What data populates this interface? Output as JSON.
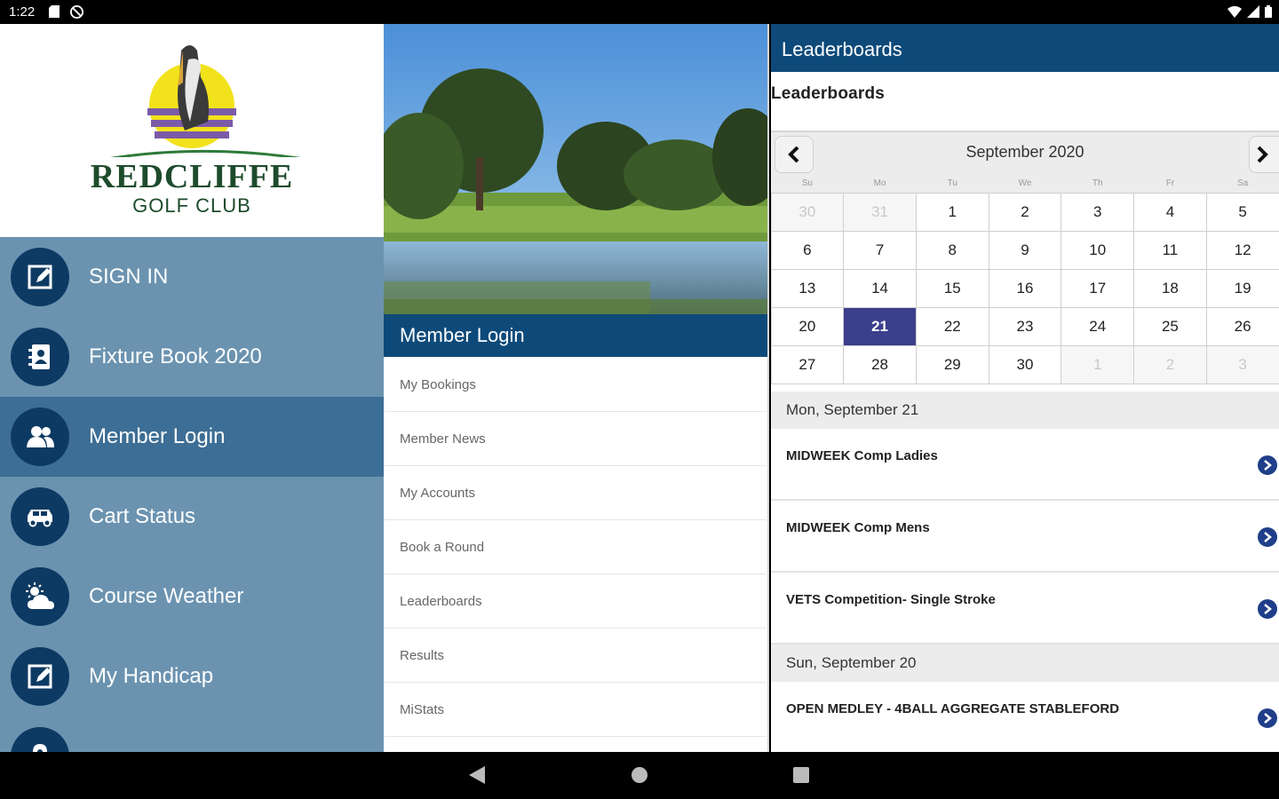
{
  "status_bar": {
    "time": "1:22",
    "left_icons": [
      "sd-card-icon",
      "no-disturb-icon"
    ],
    "right_icons": [
      "wifi-icon",
      "cell-signal-icon",
      "battery-icon"
    ]
  },
  "brand": {
    "title": "REDCLIFFE",
    "subtitle": "GOLF CLUB",
    "colors": {
      "logo_green": "#1e4b2c",
      "sun_yellow": "#f2e21c",
      "water_purple": "#7b5ba8"
    }
  },
  "sidebar": {
    "items": [
      {
        "label": "SIGN IN",
        "icon": "edit-icon",
        "active": false
      },
      {
        "label": "Fixture Book 2020",
        "icon": "contact-book-icon",
        "active": false
      },
      {
        "label": "Member Login",
        "icon": "people-icon",
        "active": true
      },
      {
        "label": "Cart Status",
        "icon": "car-icon",
        "active": false
      },
      {
        "label": "Course Weather",
        "icon": "weather-icon",
        "active": false
      },
      {
        "label": "My Handicap",
        "icon": "edit-icon",
        "active": false
      }
    ],
    "colors": {
      "background": "#6b93b0",
      "active": "#3d6e95",
      "icon_circle": "#0d3a63"
    }
  },
  "member_panel": {
    "title": "Member Login",
    "items": [
      "My Bookings",
      "Member News",
      "My Accounts",
      "Book a Round",
      "Leaderboards",
      "Results",
      "MiStats"
    ]
  },
  "leaderboards": {
    "header": "Leaderboards",
    "subtitle": "Leaderboards",
    "calendar": {
      "month_label": "September 2020",
      "dow": [
        "Su",
        "Mo",
        "Tu",
        "We",
        "Th",
        "Fr",
        "Sa"
      ],
      "weeks": [
        [
          {
            "d": "30",
            "out": true
          },
          {
            "d": "31",
            "out": true
          },
          {
            "d": "1"
          },
          {
            "d": "2"
          },
          {
            "d": "3"
          },
          {
            "d": "4"
          },
          {
            "d": "5"
          }
        ],
        [
          {
            "d": "6"
          },
          {
            "d": "7"
          },
          {
            "d": "8"
          },
          {
            "d": "9"
          },
          {
            "d": "10"
          },
          {
            "d": "11"
          },
          {
            "d": "12"
          }
        ],
        [
          {
            "d": "13"
          },
          {
            "d": "14"
          },
          {
            "d": "15"
          },
          {
            "d": "16"
          },
          {
            "d": "17"
          },
          {
            "d": "18"
          },
          {
            "d": "19"
          }
        ],
        [
          {
            "d": "20"
          },
          {
            "d": "21",
            "selected": true
          },
          {
            "d": "22"
          },
          {
            "d": "23"
          },
          {
            "d": "24"
          },
          {
            "d": "25"
          },
          {
            "d": "26"
          }
        ],
        [
          {
            "d": "27"
          },
          {
            "d": "28"
          },
          {
            "d": "29"
          },
          {
            "d": "30"
          },
          {
            "d": "1",
            "out": true
          },
          {
            "d": "2",
            "out": true
          },
          {
            "d": "3",
            "out": true
          }
        ]
      ]
    },
    "days": [
      {
        "date_label": "Mon, September 21",
        "events": [
          "MIDWEEK Comp Ladies",
          "MIDWEEK Comp Mens",
          "VETS Competition- Single Stroke"
        ]
      },
      {
        "date_label": "Sun, September 20",
        "events": [
          "OPEN MEDLEY - 4BALL AGGREGATE STABLEFORD"
        ]
      }
    ],
    "colors": {
      "header": "#0d4a7a",
      "selected_day": "#3b3f8c",
      "chevron": "#1f3f8a"
    }
  },
  "nav_bar": {
    "buttons": [
      "back-icon",
      "home-icon",
      "recents-icon"
    ]
  }
}
